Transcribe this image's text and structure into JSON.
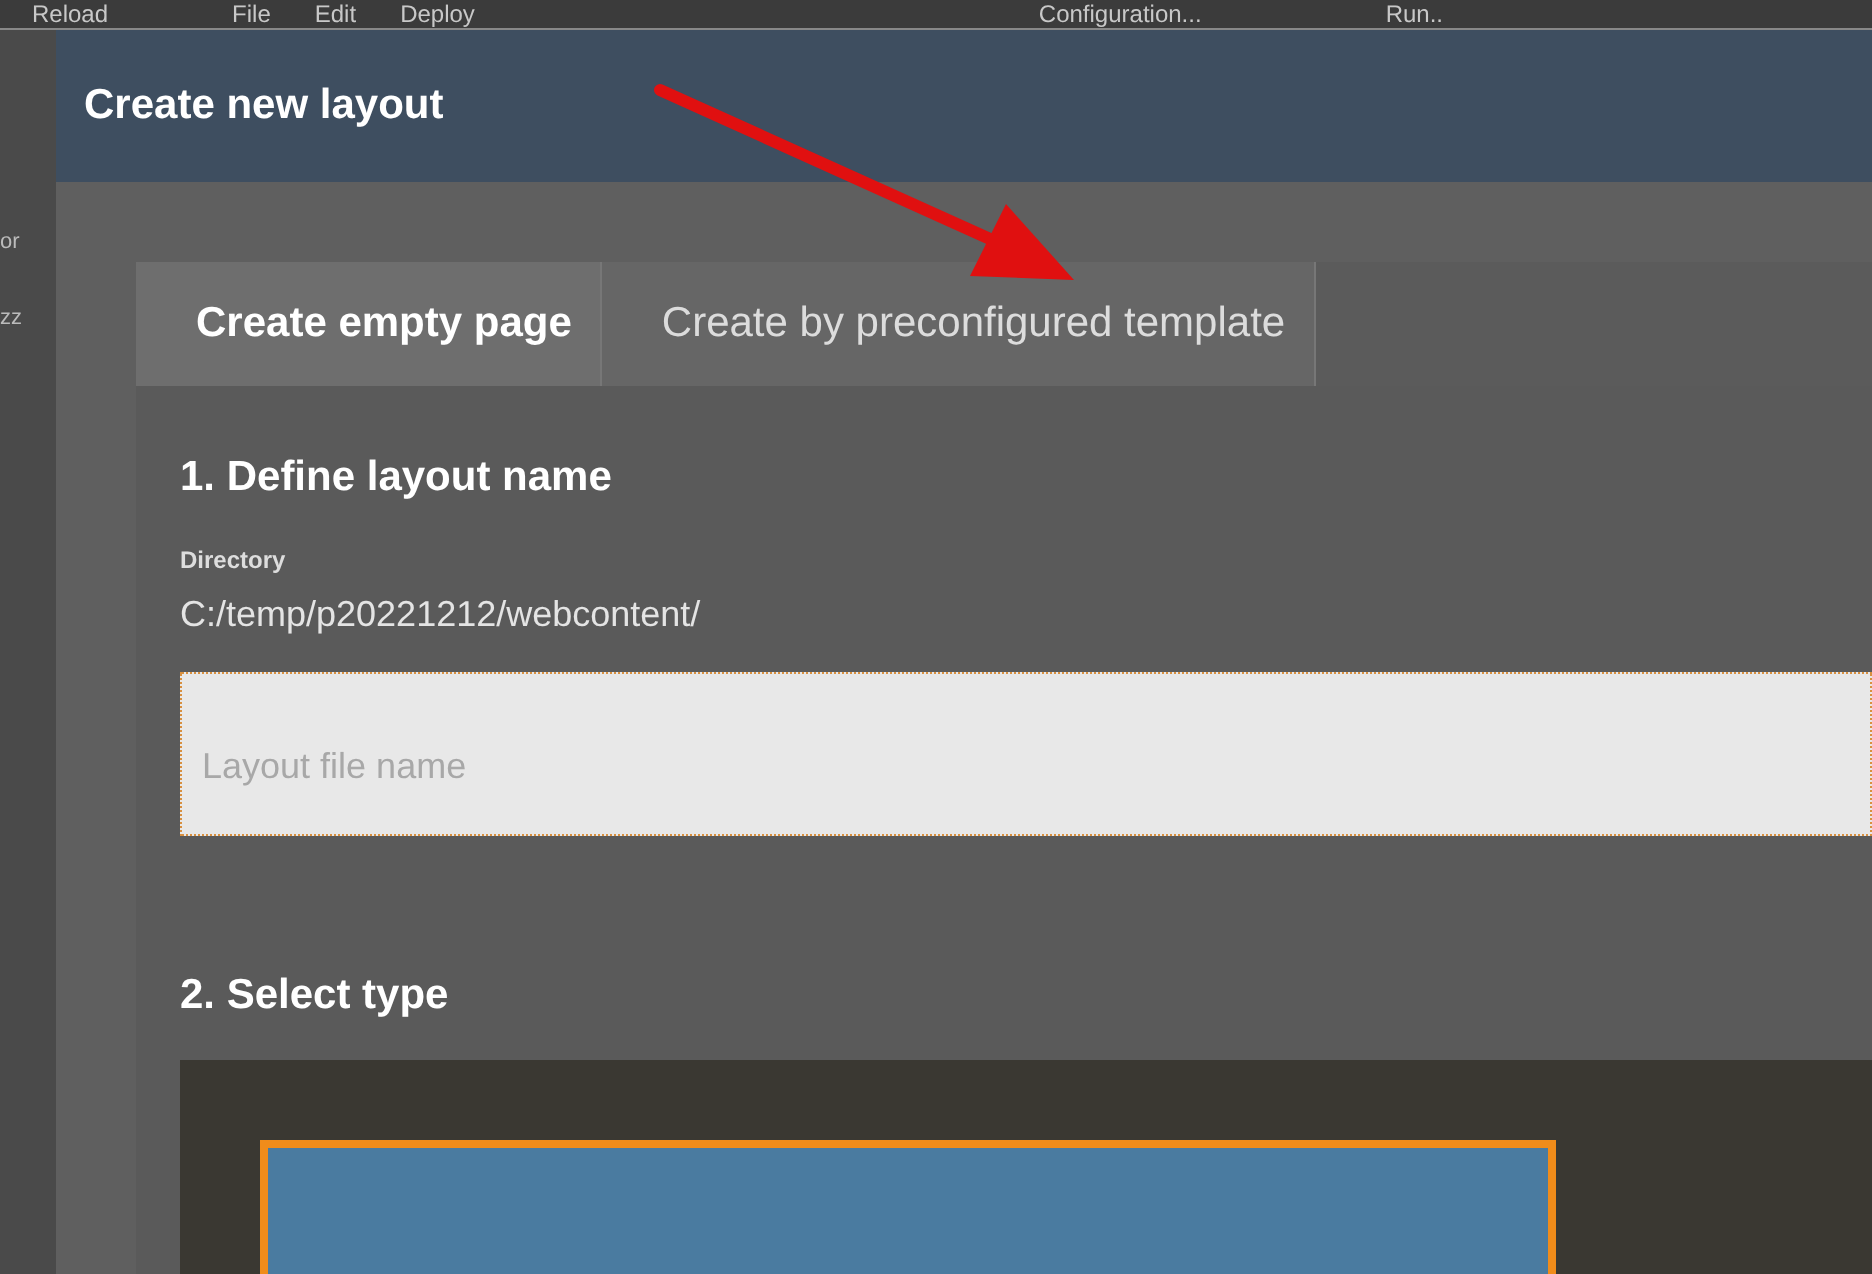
{
  "menu_bar": {
    "items": [
      "Reload",
      "File",
      "Edit",
      "Deploy",
      "Configuration...",
      "Run.."
    ]
  },
  "background_sidebar": {
    "texts": [
      "or",
      "zz"
    ]
  },
  "dialog": {
    "title": "Create new layout",
    "tabs": [
      {
        "label": "Create empty page",
        "selected": true
      },
      {
        "label": "Create by preconfigured template",
        "selected": false
      }
    ],
    "section_1": {
      "heading": "1. Define layout name",
      "directory_label": "Directory",
      "directory_path": "C:/temp/p20221212/webcontent/",
      "file_name_field": {
        "placeholder": "Layout file name"
      }
    },
    "section_2": {
      "heading": "2. Select type"
    }
  }
}
